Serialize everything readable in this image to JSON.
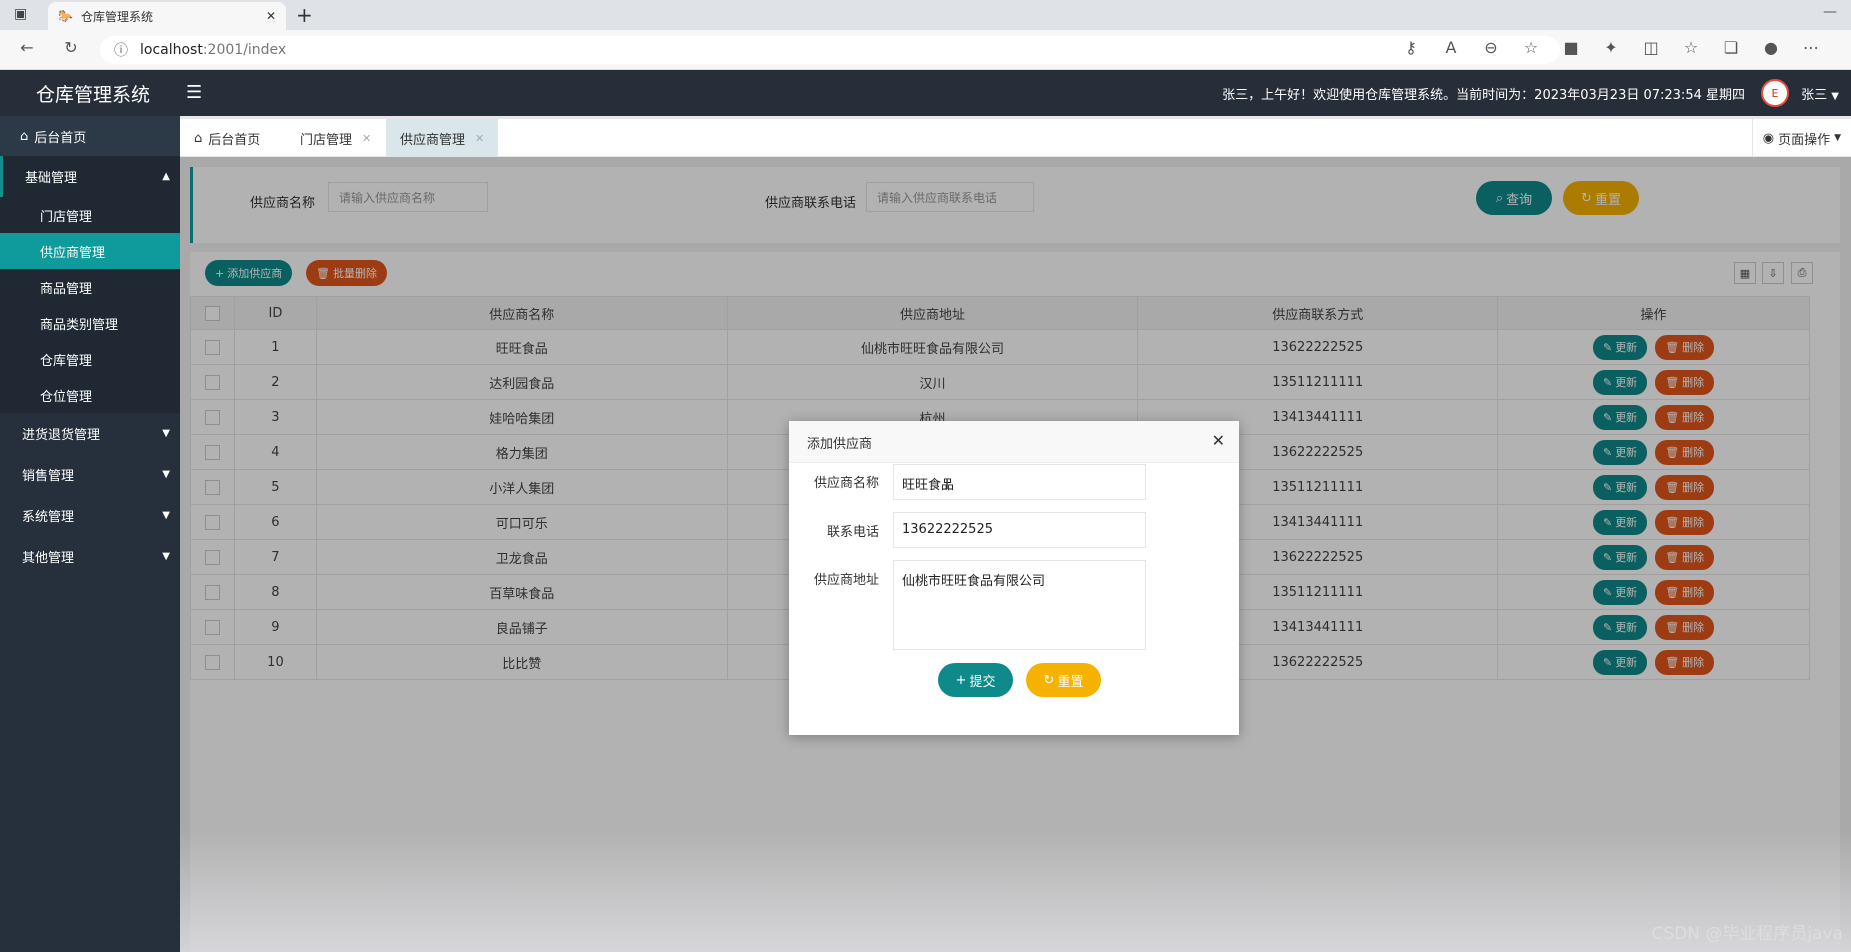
{
  "browser": {
    "tab_title": "仓库管理系统",
    "url_host": "localhost",
    "url_rest": ":2001/index"
  },
  "header": {
    "brand": "仓库管理系统",
    "welcome": "张三，上午好！欢迎使用仓库管理系统。当前时间为：2023年03月23日 07:23:54 星期四",
    "user": "张三",
    "avatar_text": "E"
  },
  "sidebar": {
    "home": "后台首页",
    "groups": [
      {
        "label": "基础管理"
      },
      {
        "label": "进货退货管理"
      },
      {
        "label": "销售管理"
      },
      {
        "label": "系统管理"
      },
      {
        "label": "其他管理"
      }
    ],
    "items": [
      "门店管理",
      "供应商管理",
      "商品管理",
      "商品类别管理",
      "仓库管理",
      "仓位管理"
    ]
  },
  "tabs": {
    "items": [
      "后台首页",
      "门店管理",
      "供应商管理"
    ],
    "page_ops": "页面操作"
  },
  "search": {
    "name_label": "供应商名称",
    "name_placeholder": "请输入供应商名称",
    "phone_label": "供应商联系电话",
    "phone_placeholder": "请输入供应商联系电话",
    "query": "查询",
    "reset": "重置"
  },
  "toolbar": {
    "add": "添加供应商",
    "batch_delete": "批量删除"
  },
  "table": {
    "headers": [
      "ID",
      "供应商名称",
      "供应商地址",
      "供应商联系方式",
      "操作"
    ],
    "rows": [
      {
        "id": "1",
        "name": "旺旺食品",
        "addr": "仙桃市旺旺食品有限公司",
        "phone": "13622222525"
      },
      {
        "id": "2",
        "name": "达利园食品",
        "addr": "汉川",
        "phone": "13511211111"
      },
      {
        "id": "3",
        "name": "娃哈哈集团",
        "addr": "杭州",
        "phone": "13413441111"
      },
      {
        "id": "4",
        "name": "格力集团",
        "addr": "",
        "phone": "13622222525"
      },
      {
        "id": "5",
        "name": "小洋人集团",
        "addr": "",
        "phone": "13511211111"
      },
      {
        "id": "6",
        "name": "可口可乐",
        "addr": "",
        "phone": "13413441111"
      },
      {
        "id": "7",
        "name": "卫龙食品",
        "addr": "",
        "phone": "13622222525"
      },
      {
        "id": "8",
        "name": "百草味食品",
        "addr": "",
        "phone": "13511211111"
      },
      {
        "id": "9",
        "name": "良品铺子",
        "addr": "",
        "phone": "13413441111"
      },
      {
        "id": "10",
        "name": "比比赞",
        "addr": "",
        "phone": "13622222525"
      }
    ],
    "update": "更新",
    "delete": "删除"
  },
  "dialog": {
    "title": "添加供应商",
    "name_label": "供应商名称",
    "name_value": "旺旺食品",
    "phone_label": "联系电话",
    "phone_value": "13622222525",
    "addr_label": "供应商地址",
    "addr_value": "仙桃市旺旺食品有限公司",
    "submit": "提交",
    "reset": "重置"
  },
  "watermark": "CSDN @毕业程序员java",
  "colors": {
    "teal": "#0f8a8a",
    "orange": "#e1571c",
    "yellow": "#f5b200",
    "header": "#262e3a"
  }
}
